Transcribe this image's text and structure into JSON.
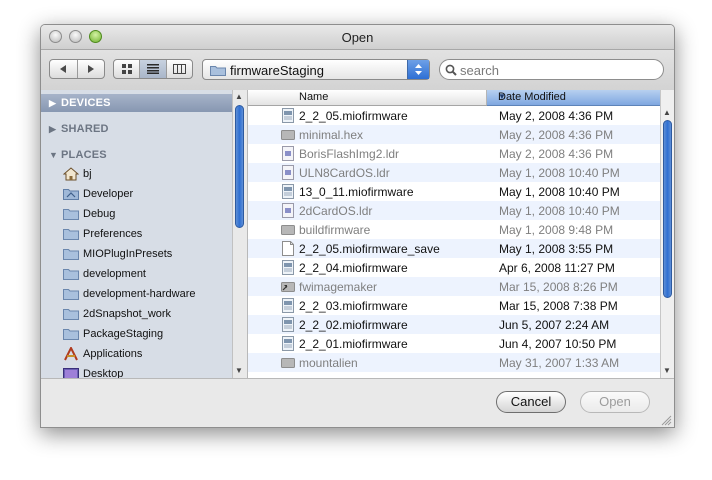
{
  "window": {
    "title": "Open"
  },
  "toolbar": {
    "location": "firmwareStaging",
    "search_placeholder": "search",
    "view_mode": "list"
  },
  "sidebar": {
    "sections": [
      {
        "label": "DEVICES",
        "selected": true,
        "expanded": false
      },
      {
        "label": "SHARED",
        "selected": false,
        "expanded": false
      },
      {
        "label": "PLACES",
        "selected": false,
        "expanded": true
      }
    ],
    "places": [
      {
        "label": "bj",
        "icon": "home-icon"
      },
      {
        "label": "Developer",
        "icon": "developer-folder-icon"
      },
      {
        "label": "Debug",
        "icon": "folder-icon"
      },
      {
        "label": "Preferences",
        "icon": "folder-icon"
      },
      {
        "label": "MIOPlugInPresets",
        "icon": "folder-icon"
      },
      {
        "label": "development",
        "icon": "folder-icon"
      },
      {
        "label": "development-hardware",
        "icon": "folder-icon"
      },
      {
        "label": "2dSnapshot_work",
        "icon": "folder-icon"
      },
      {
        "label": "PackageStaging",
        "icon": "folder-icon"
      },
      {
        "label": "Applications",
        "icon": "applications-icon"
      },
      {
        "label": "Desktop",
        "icon": "desktop-icon"
      }
    ]
  },
  "list": {
    "columns": [
      "Name",
      "Date Modified"
    ],
    "sorted_column": "Date Modified",
    "files": [
      {
        "name": "2_2_05.miofirmware",
        "date": "May 2, 2008 4:36 PM",
        "icon": "firmware-file-icon",
        "enabled": true
      },
      {
        "name": "minimal.hex",
        "date": "May 2, 2008 4:36 PM",
        "icon": "gray-file-icon",
        "enabled": false
      },
      {
        "name": "BorisFlashImg2.ldr",
        "date": "May 2, 2008 4:36 PM",
        "icon": "ldr-file-icon",
        "enabled": false
      },
      {
        "name": "ULN8CardOS.ldr",
        "date": "May 1, 2008 10:40 PM",
        "icon": "ldr-file-icon",
        "enabled": false
      },
      {
        "name": "13_0_11.miofirmware",
        "date": "May 1, 2008 10:40 PM",
        "icon": "firmware-file-icon",
        "enabled": true
      },
      {
        "name": "2dCardOS.ldr",
        "date": "May 1, 2008 10:40 PM",
        "icon": "ldr-file-icon",
        "enabled": false
      },
      {
        "name": "buildfirmware",
        "date": "May 1, 2008 9:48 PM",
        "icon": "gray-file-icon",
        "enabled": false
      },
      {
        "name": "2_2_05.miofirmware_save",
        "date": "May 1, 2008 3:55 PM",
        "icon": "document-icon",
        "enabled": true
      },
      {
        "name": "2_2_04.miofirmware",
        "date": "Apr 6, 2008 11:27 PM",
        "icon": "firmware-file-icon",
        "enabled": true
      },
      {
        "name": "fwimagemaker",
        "date": "Mar 15, 2008 8:26 PM",
        "icon": "alias-file-icon",
        "enabled": false
      },
      {
        "name": "2_2_03.miofirmware",
        "date": "Mar 15, 2008 7:38 PM",
        "icon": "firmware-file-icon",
        "enabled": true
      },
      {
        "name": "2_2_02.miofirmware",
        "date": "Jun 5, 2007 2:24 AM",
        "icon": "firmware-file-icon",
        "enabled": true
      },
      {
        "name": "2_2_01.miofirmware",
        "date": "Jun 4, 2007 10:50 PM",
        "icon": "firmware-file-icon",
        "enabled": true
      },
      {
        "name": "mountalien",
        "date": "May 31, 2007 1:33 AM",
        "icon": "gray-file-icon",
        "enabled": false
      }
    ]
  },
  "buttons": {
    "cancel": "Cancel",
    "open": "Open"
  }
}
